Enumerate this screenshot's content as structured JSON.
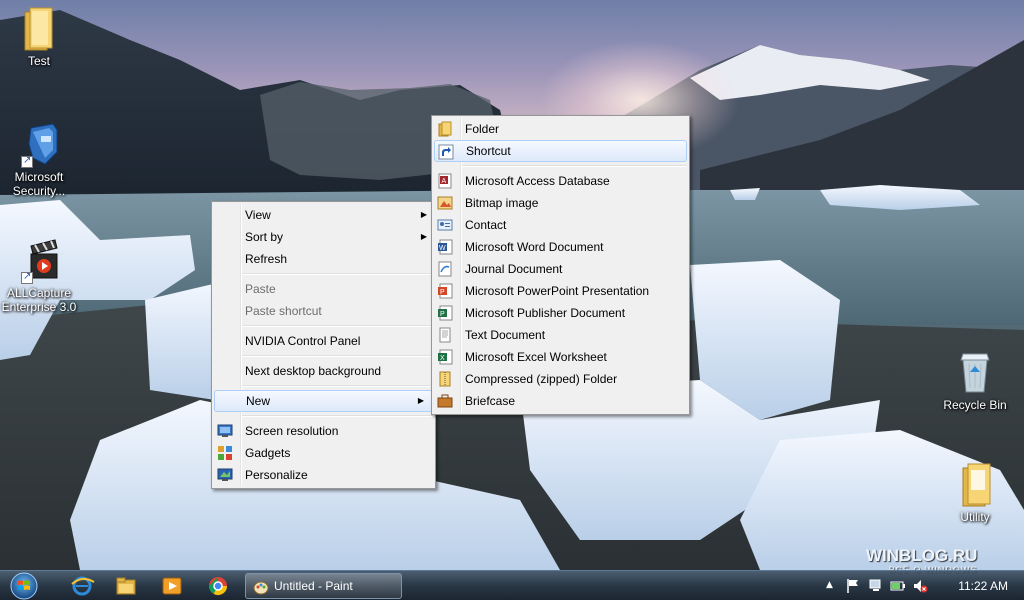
{
  "desktop": {
    "icons": [
      {
        "id": "test",
        "label": "Test"
      },
      {
        "id": "mse",
        "label": "Microsoft\nSecurity..."
      },
      {
        "id": "allcapture",
        "label": "ALLCapture\nEnterprise 3.0"
      },
      {
        "id": "recycle",
        "label": "Recycle Bin"
      },
      {
        "id": "utility",
        "label": "Utility"
      }
    ]
  },
  "context_menu": {
    "items": {
      "view": "View",
      "sort_by": "Sort by",
      "refresh": "Refresh",
      "paste": "Paste",
      "paste_shortcut": "Paste shortcut",
      "nvidia": "NVIDIA Control Panel",
      "next_bg": "Next desktop background",
      "new": "New",
      "screen_resolution": "Screen resolution",
      "gadgets": "Gadgets",
      "personalize": "Personalize"
    }
  },
  "new_submenu": {
    "items": [
      "Folder",
      "Shortcut",
      "Microsoft Access Database",
      "Bitmap image",
      "Contact",
      "Microsoft Word Document",
      "Journal Document",
      "Microsoft PowerPoint Presentation",
      "Microsoft Publisher Document",
      "Text Document",
      "Microsoft Excel Worksheet",
      "Compressed (zipped) Folder",
      "Briefcase"
    ]
  },
  "taskbar": {
    "active_task": "Untitled - Paint",
    "clock": "11:22 AM"
  },
  "watermark": {
    "brand": "WINBLOG.RU",
    "tagline": "ВСЁ О WINDOWS"
  },
  "colors": {
    "menu_bg": "#f0f0f0",
    "highlight_border": "#aecff7",
    "taskbar": "#1e2d3c"
  }
}
